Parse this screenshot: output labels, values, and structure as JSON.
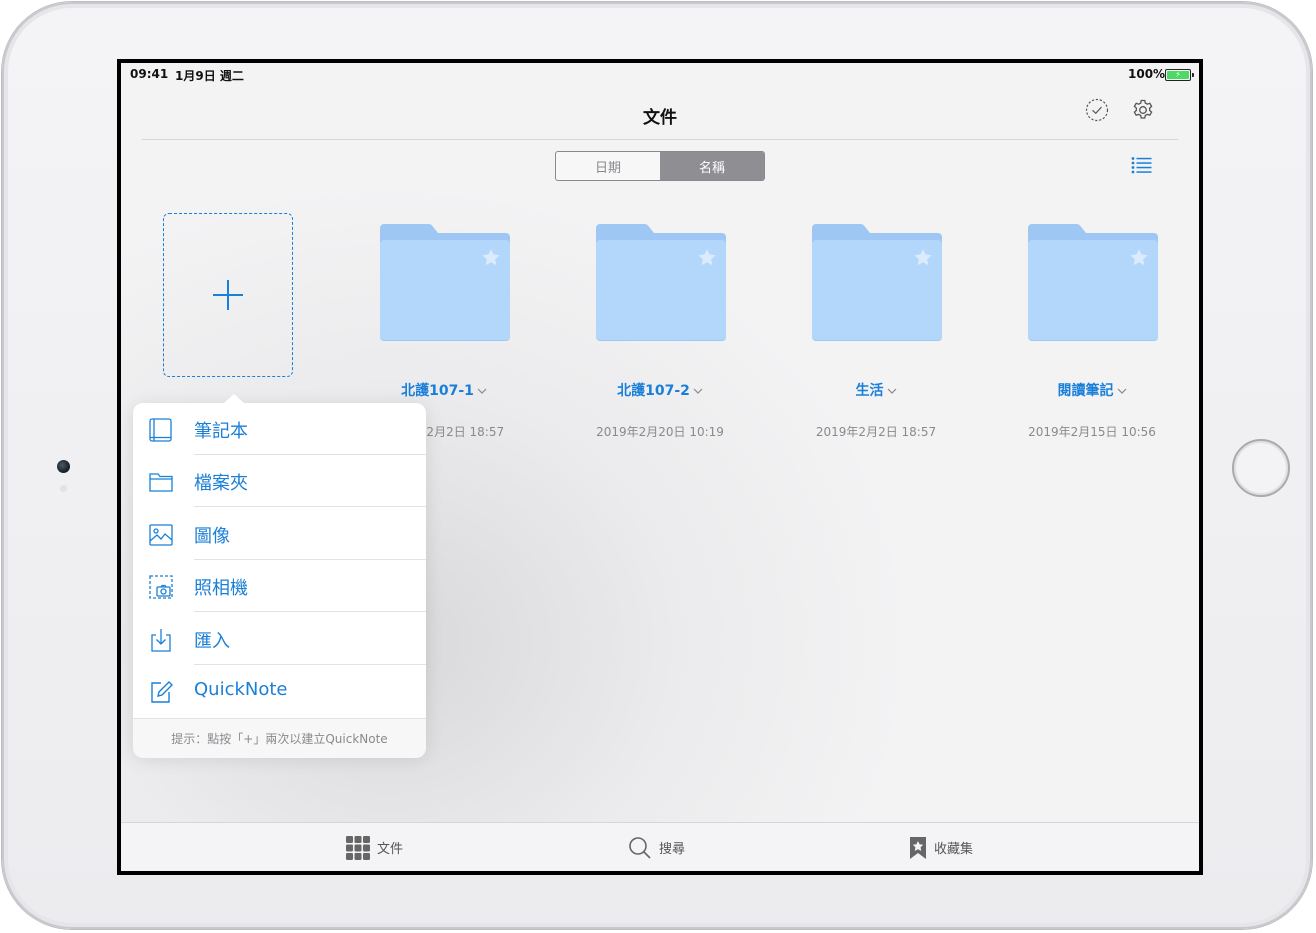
{
  "status_bar": {
    "time": "09:41",
    "date": "1月9日 週二",
    "battery": "100%"
  },
  "nav": {
    "title": "文件"
  },
  "sort": {
    "options": [
      "日期",
      "名稱"
    ],
    "selected": "名稱"
  },
  "folders": [
    {
      "name": "北護107-1",
      "date": "2019年2月2日 18:57"
    },
    {
      "name": "北護107-2",
      "date": "2019年2月20日 10:19"
    },
    {
      "name": "生活",
      "date": "2019年2月2日 18:57"
    },
    {
      "name": "閱讀筆記",
      "date": "2019年2月15日 10:56"
    }
  ],
  "create_menu": {
    "items": [
      {
        "label": "筆記本",
        "icon": "notebook-icon"
      },
      {
        "label": "檔案夾",
        "icon": "folder-icon"
      },
      {
        "label": "圖像",
        "icon": "image-icon"
      },
      {
        "label": "照相機",
        "icon": "camera-icon"
      },
      {
        "label": "匯入",
        "icon": "import-icon"
      },
      {
        "label": "QuickNote",
        "icon": "quicknote-icon"
      }
    ],
    "tip": "提示：點按「+」兩次以建立QuickNote"
  },
  "tab_bar": {
    "documents": "文件",
    "search": "搜尋",
    "favorites": "收藏集"
  },
  "colors": {
    "accent": "#1a7fd8",
    "folder": "#b3d6fb",
    "folder_tab": "#9fc7f4",
    "battery": "#4cd964"
  }
}
